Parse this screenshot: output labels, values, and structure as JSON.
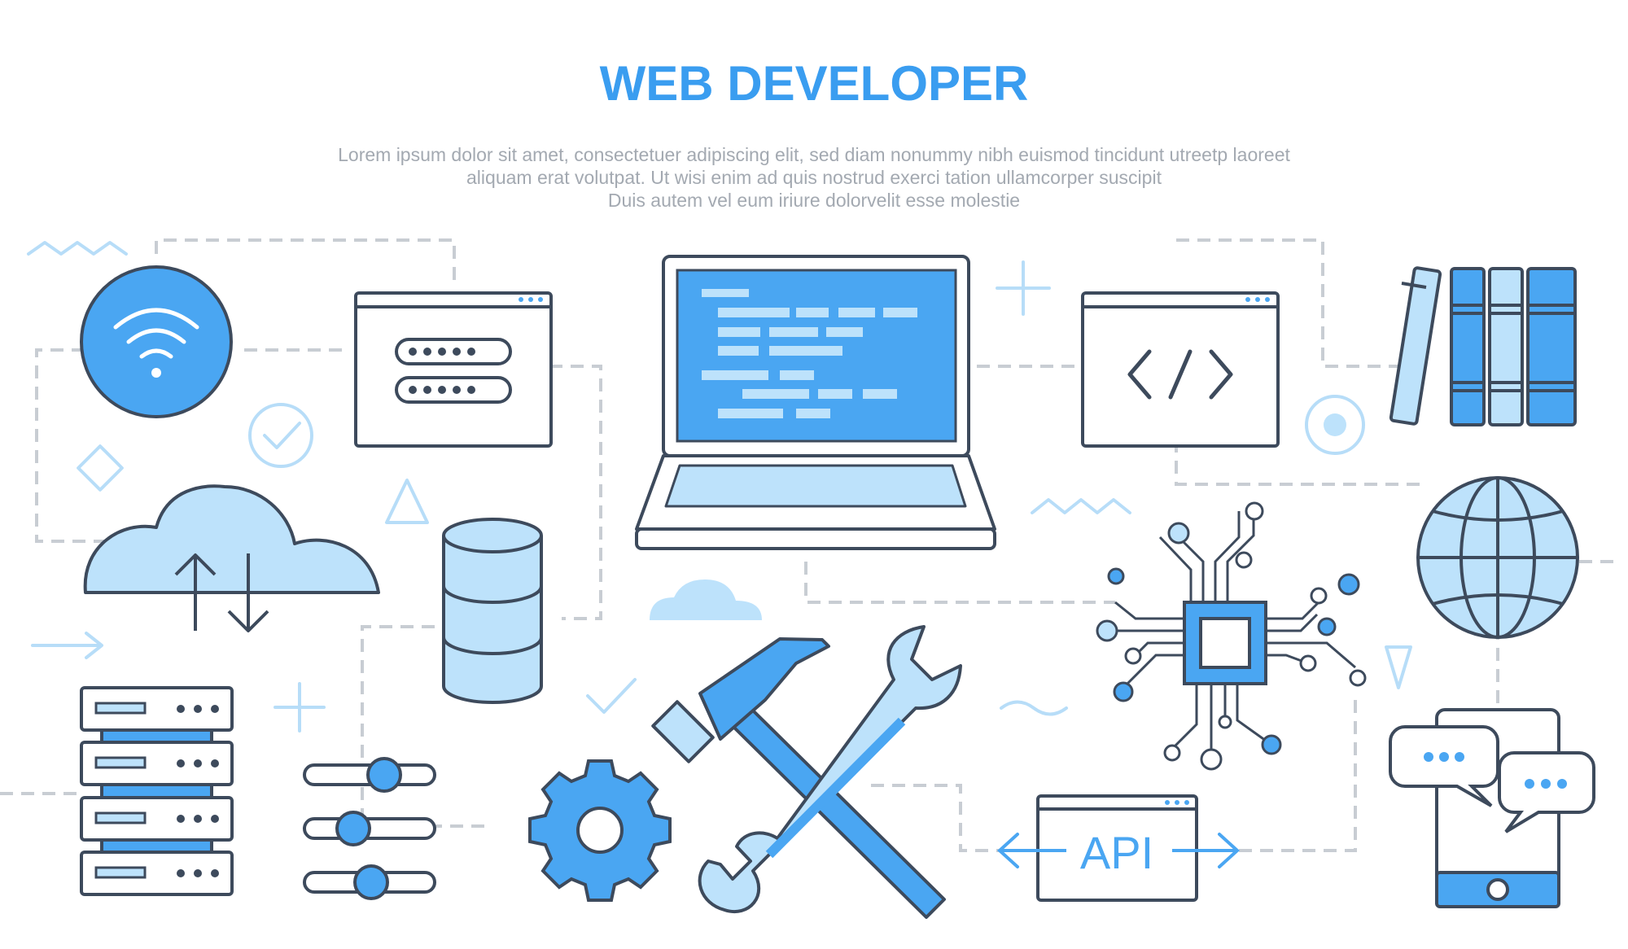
{
  "header": {
    "title": "WEB DEVELOPER",
    "subtitle_lines": [
      "Lorem ipsum dolor sit amet, consectetuer adipiscing elit, sed diam nonummy nibh euismod tincidunt utreetp laoreet",
      "aliquam erat volutpat. Ut wisi enim ad  quis nostrud exerci tation ullamcorper suscipit",
      "Duis autem vel eum iriure dolorvelit esse molestie"
    ]
  },
  "api_window": {
    "label": "API"
  },
  "colors": {
    "primary": "#4aa6f2",
    "light": "#bde2fb",
    "outline": "#3d4a5c",
    "dash": "#c8cdd3",
    "title": "#3a9df0",
    "subtitle": "#a3a9b1"
  },
  "icons": [
    "wifi-icon",
    "password-window-icon",
    "laptop-code-icon",
    "code-window-icon",
    "books-icon",
    "cloud-transfer-icon",
    "database-icon",
    "globe-icon",
    "circuit-chip-icon",
    "server-rack-icon",
    "sliders-icon",
    "gear-icon",
    "hammer-wrench-icon",
    "api-window-icon",
    "smartphone-chat-icon"
  ]
}
